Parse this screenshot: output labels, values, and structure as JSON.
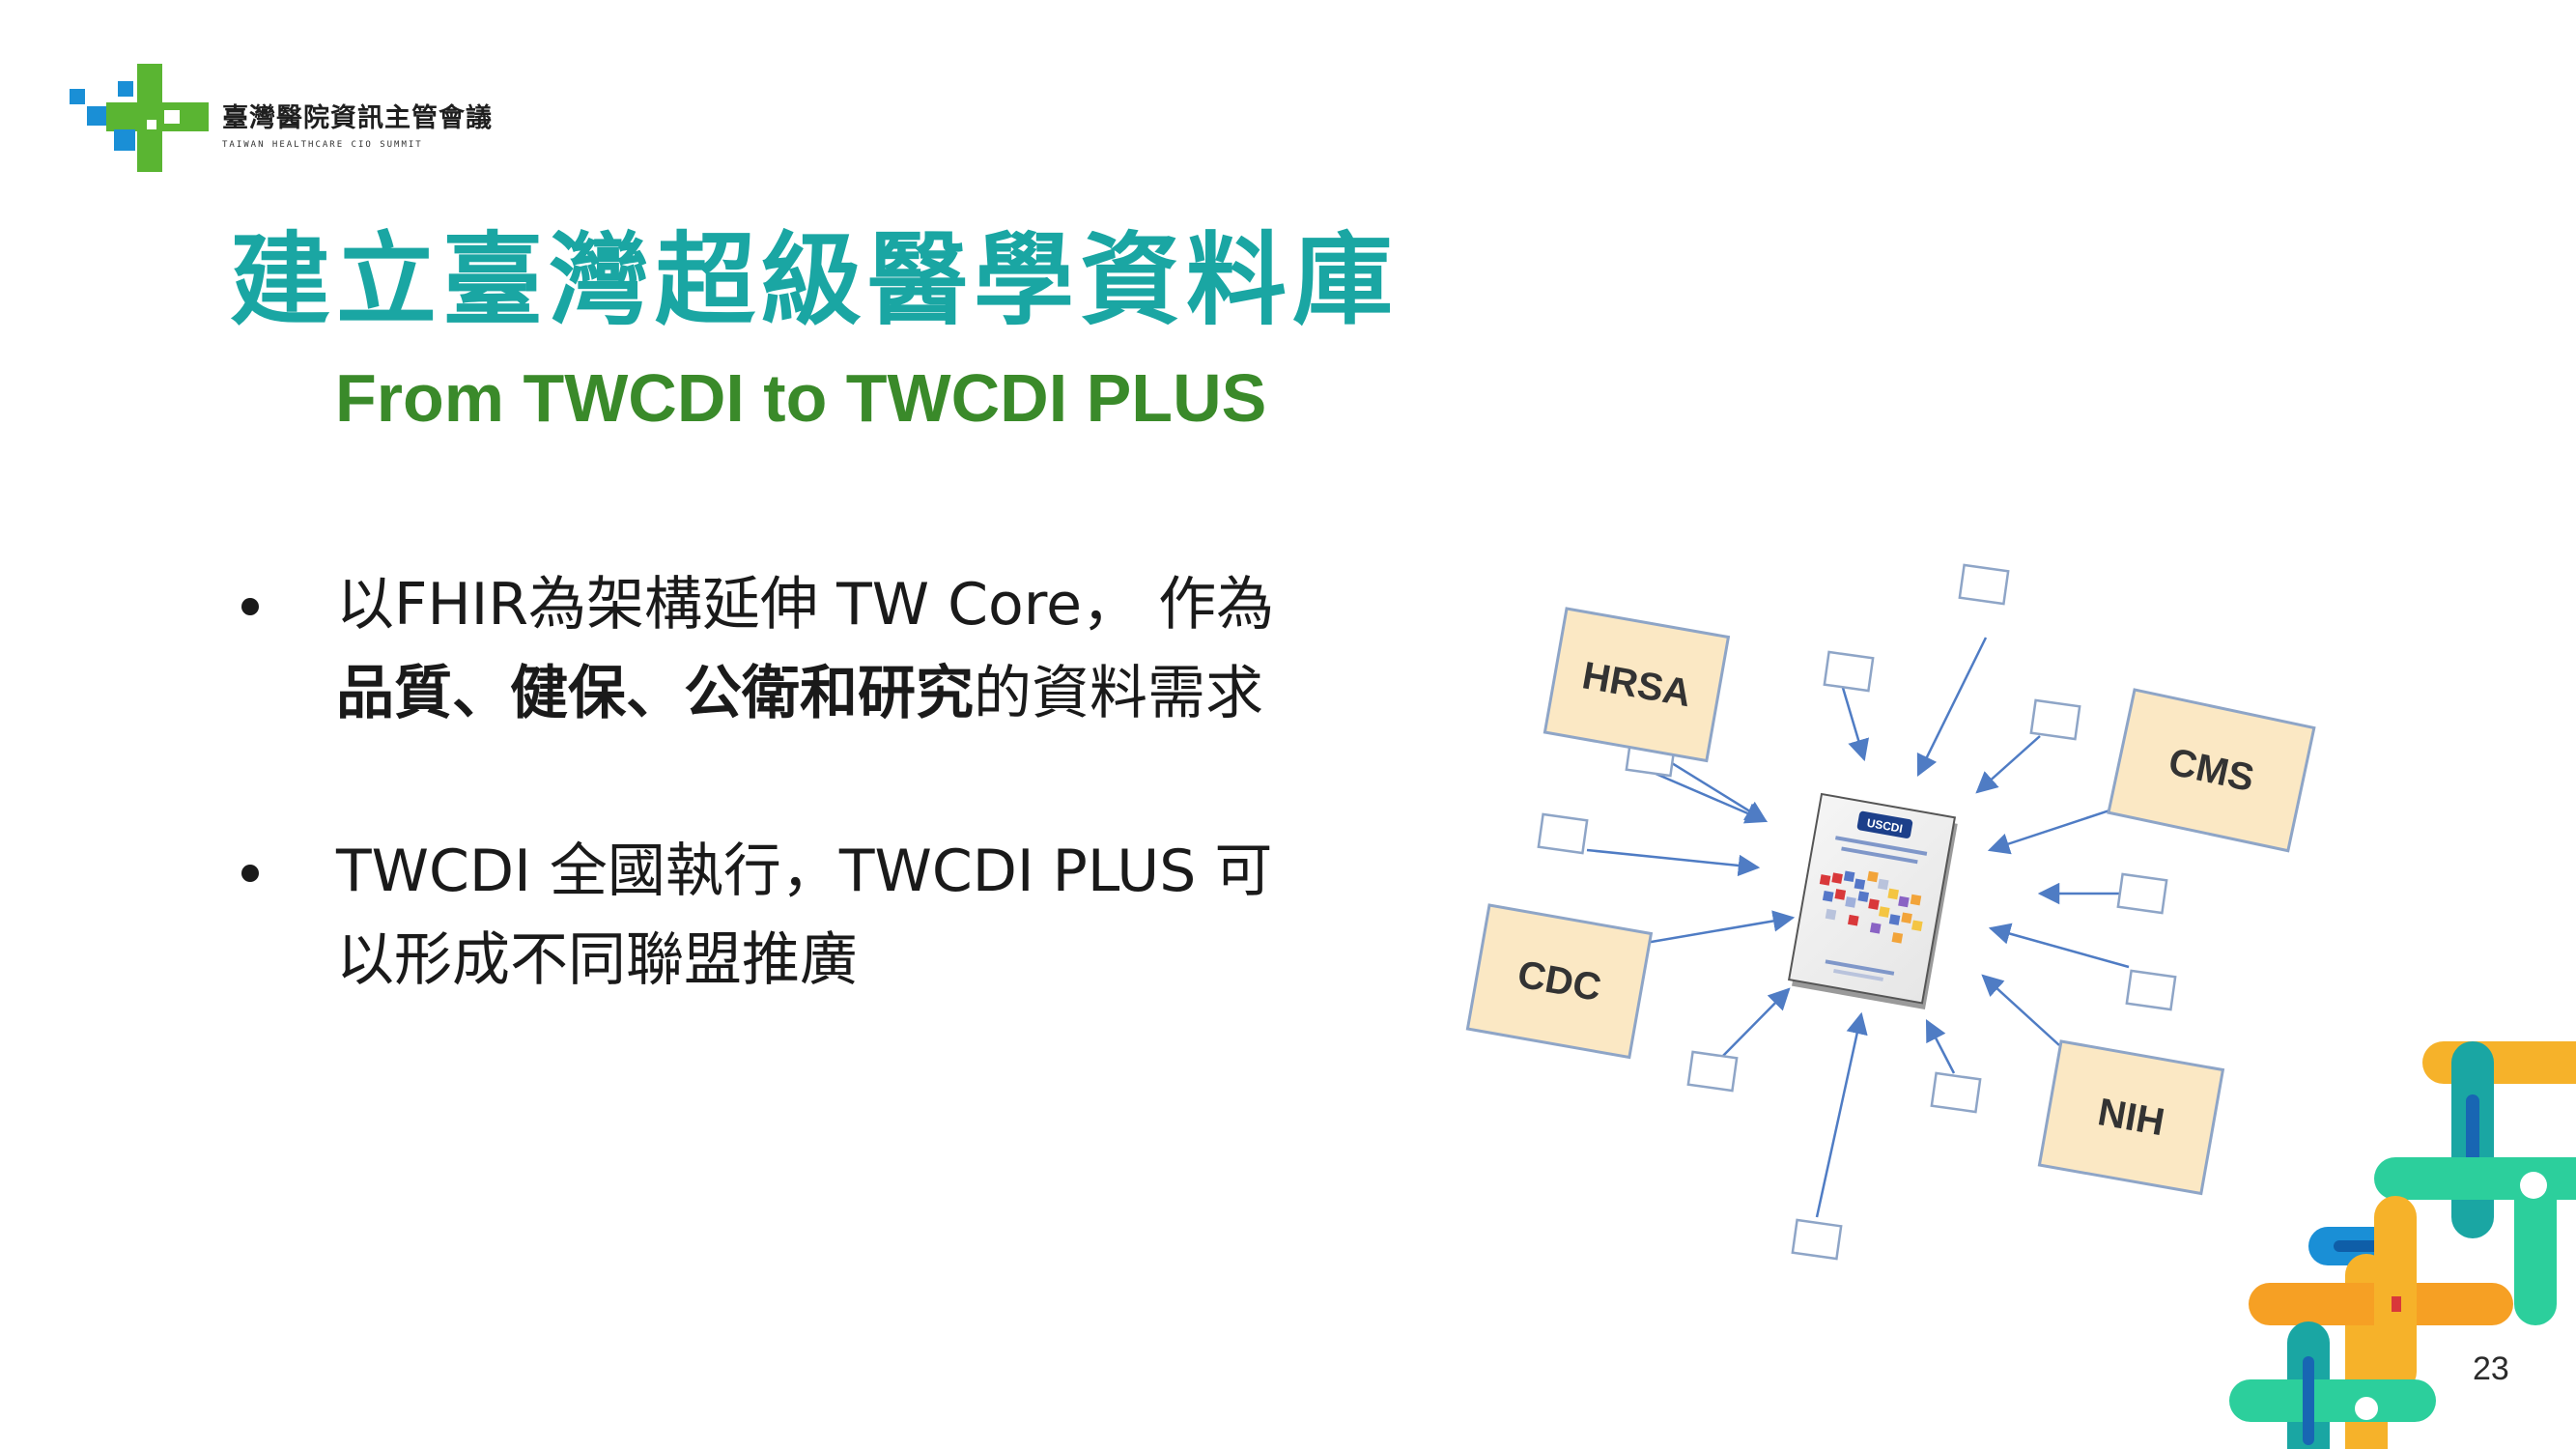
{
  "header": {
    "logo_cn": "臺灣醫院資訊主管會議",
    "logo_en": "TAIWAN HEALTHCARE CIO SUMMIT",
    "colors": {
      "green": "#5ab532",
      "blue": "#1a8fd6",
      "teal": "#1aa6a3"
    }
  },
  "slide": {
    "title": "建立臺灣超級醫學資料庫",
    "subtitle": "From TWCDI to TWCDI PLUS",
    "bullets": [
      {
        "line1": "以FHIR為架構延伸 TW Core， 作為",
        "line2_bold": "品質、健保、公衛和研究",
        "line2_rest": "的資料需求"
      },
      {
        "line1": "TWCDI 全國執行，TWCDI PLUS 可",
        "line2": "以形成不同聯盟推廣"
      }
    ],
    "page_number": "23"
  },
  "diagram": {
    "agencies": [
      "HRSA",
      "CMS",
      "CDC",
      "NIH"
    ],
    "center_doc_label": "USCDI",
    "box_fill": "#fbe8c4",
    "box_stroke": "#8ea5c7",
    "arrow_color": "#4f7cc4"
  }
}
